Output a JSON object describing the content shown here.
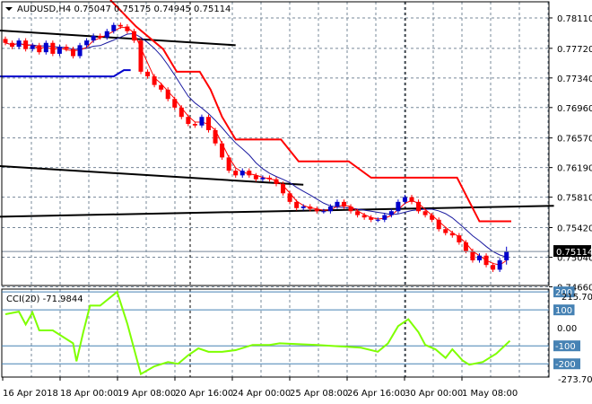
{
  "header": {
    "symbol": "AUDUSD,H4",
    "open": "0.75047",
    "high": "0.75175",
    "low": "0.74945",
    "close": "0.75114"
  },
  "colors": {
    "bull": "#0000cc",
    "bear": "#ff0000",
    "ma_slow": "#1a1aa0",
    "ma_fast": "#ff0000",
    "step": "#ff0000",
    "cci": "#7fff00",
    "level": "#4682b4",
    "grid": "#778899"
  },
  "chart_data": [
    {
      "type": "candlestick",
      "title": "AUDUSD,H4",
      "price_axis": [
        "0.78110",
        "0.77720",
        "0.77340",
        "0.76960",
        "0.76570",
        "0.76190",
        "0.75810",
        "0.75420",
        "0.75040",
        "0.74660"
      ],
      "current_price": "0.75114",
      "ylim": [
        0.74677,
        0.78317
      ],
      "closes": [
        0.7779,
        0.7774,
        0.7782,
        0.7771,
        0.7776,
        0.7767,
        0.7779,
        0.7765,
        0.7774,
        0.7771,
        0.7762,
        0.7776,
        0.7782,
        0.7788,
        0.7786,
        0.7794,
        0.7802,
        0.78,
        0.7794,
        0.7782,
        0.7742,
        0.7736,
        0.7725,
        0.7719,
        0.7707,
        0.7696,
        0.7684,
        0.7675,
        0.7673,
        0.7684,
        0.7667,
        0.765,
        0.7632,
        0.7615,
        0.7609,
        0.7615,
        0.7609,
        0.7604,
        0.7606,
        0.7604,
        0.7598,
        0.7586,
        0.7575,
        0.7567,
        0.7569,
        0.7566,
        0.7563,
        0.7563,
        0.7569,
        0.7575,
        0.7569,
        0.7563,
        0.7558,
        0.7555,
        0.7552,
        0.7552,
        0.7558,
        0.7563,
        0.7575,
        0.7581,
        0.7575,
        0.7563,
        0.7558,
        0.7552,
        0.754,
        0.7535,
        0.7532,
        0.7523,
        0.7512,
        0.75,
        0.7506,
        0.7494,
        0.7488,
        0.75,
        0.75114
      ],
      "first_open": 0.7784,
      "step_line": [
        [
          15.5,
          0.7834
        ],
        [
          19.3,
          0.78
        ],
        [
          23.3,
          0.7771
        ],
        [
          25.3,
          0.7742
        ],
        [
          28.7,
          0.7742
        ],
        [
          30.3,
          0.7719
        ],
        [
          32,
          0.7684
        ],
        [
          34,
          0.7655
        ],
        [
          40.7,
          0.7655
        ],
        [
          43.3,
          0.7627
        ],
        [
          50.7,
          0.7627
        ],
        [
          54,
          0.7606
        ],
        [
          66.7,
          0.7606
        ],
        [
          70,
          0.755
        ],
        [
          74.7,
          0.755
        ]
      ],
      "blue_step": [
        [
          -1,
          0.7736
        ],
        [
          16,
          0.7736
        ],
        [
          17.5,
          0.7744
        ],
        [
          18.5,
          0.7744
        ]
      ],
      "trendlines": [
        [
          [
            -1,
            0.7795
          ],
          [
            34,
            0.7776
          ]
        ],
        [
          [
            -1,
            0.7621
          ],
          [
            44,
            0.7597
          ]
        ],
        [
          [
            -1,
            0.7556
          ],
          [
            81,
            0.757
          ]
        ]
      ],
      "ma_periods": {
        "slow": 8,
        "fast": 3
      }
    },
    {
      "type": "line",
      "title": "CCI(20)",
      "last_value": "-71.9844",
      "axis_labels": {
        "top": "215.7097",
        "bottom": "-273.701",
        "zero": "0.00"
      },
      "levels": [
        {
          "value": 200,
          "label": "200"
        },
        {
          "value": 100,
          "label": "100"
        },
        {
          "value": -100,
          "label": "-100"
        },
        {
          "value": -200,
          "label": "-200"
        }
      ],
      "ylim": [
        -273.701,
        215.7097
      ],
      "points": [
        [
          0,
          76
        ],
        [
          2,
          90
        ],
        [
          3,
          19
        ],
        [
          4,
          86
        ],
        [
          5,
          -14
        ],
        [
          7,
          -14
        ],
        [
          10,
          -86
        ],
        [
          10.5,
          -186
        ],
        [
          11.5,
          -24
        ],
        [
          12.5,
          124
        ],
        [
          14,
          124
        ],
        [
          16.5,
          200
        ],
        [
          18,
          24
        ],
        [
          20,
          -257
        ],
        [
          22,
          -214
        ],
        [
          24,
          -190
        ],
        [
          25.5,
          -200
        ],
        [
          27,
          -152
        ],
        [
          28.5,
          -114
        ],
        [
          30,
          -133
        ],
        [
          32,
          -133
        ],
        [
          34,
          -124
        ],
        [
          36.5,
          -95
        ],
        [
          39,
          -95
        ],
        [
          40.5,
          -86
        ],
        [
          46,
          -95
        ],
        [
          52.5,
          -110
        ],
        [
          55,
          -133
        ],
        [
          56.5,
          -86
        ],
        [
          58,
          10
        ],
        [
          59.5,
          48
        ],
        [
          61,
          -24
        ],
        [
          62,
          -95
        ],
        [
          63.5,
          -119
        ],
        [
          65,
          -167
        ],
        [
          66,
          -119
        ],
        [
          67.5,
          -181
        ],
        [
          68.5,
          -205
        ],
        [
          70.5,
          -190
        ],
        [
          72.5,
          -143
        ],
        [
          74.5,
          -72
        ]
      ]
    }
  ],
  "time_axis": [
    "16 Apr 2018",
    "18 Apr 00:00",
    "19 Apr 08:00",
    "20 Apr 16:00",
    "24 Apr 00:00",
    "25 Apr 08:00",
    "26 Apr 16:00",
    "30 Apr 00:00",
    "1 May 08:00"
  ]
}
